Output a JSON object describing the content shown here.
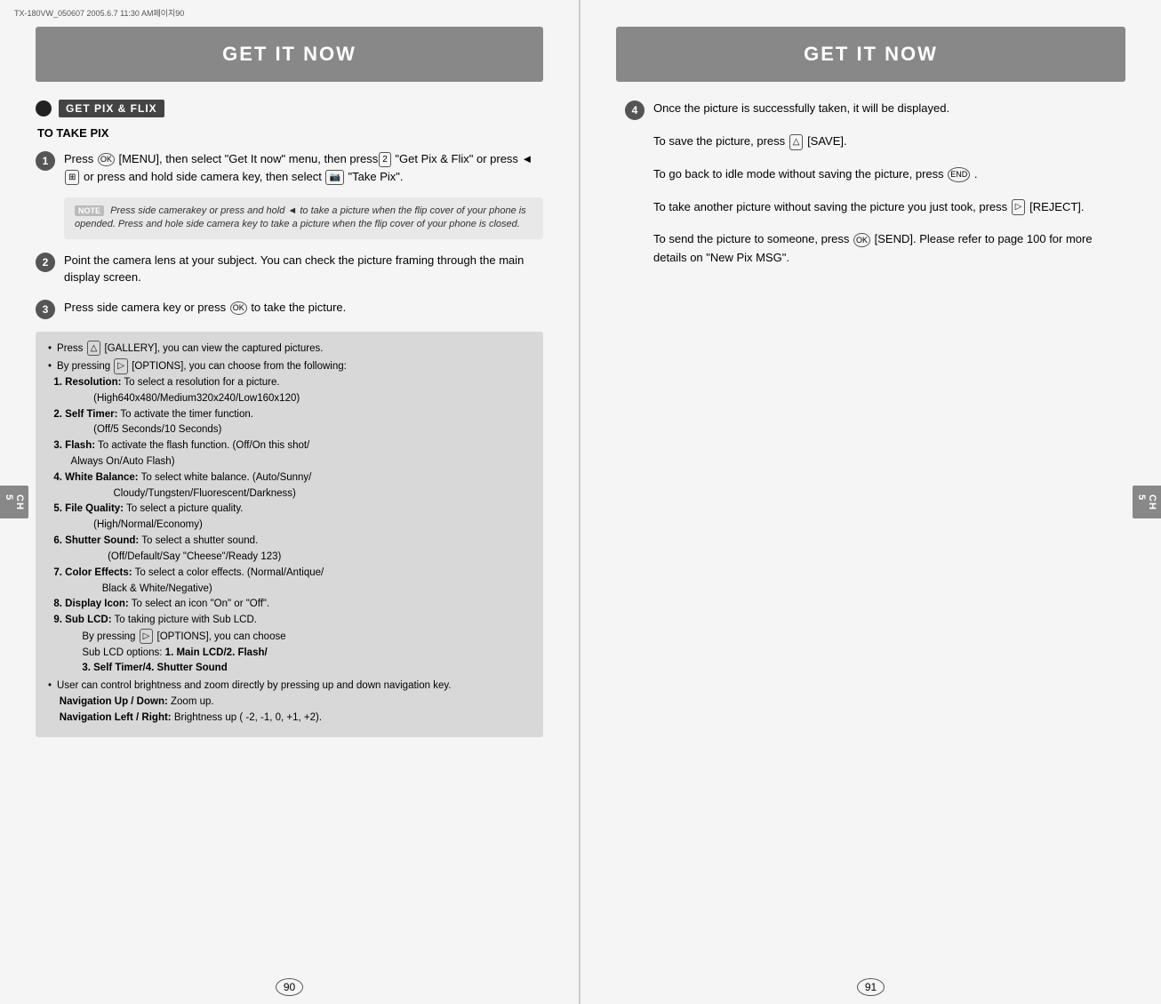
{
  "meta": {
    "top_meta": "TX-180VW_050607  2005.6.7 11:30 AM페이지90"
  },
  "left": {
    "banner_title": "GET IT NOW",
    "section_tag": "GET PIX & FLIX",
    "subsection_title": "TO TAKE PIX",
    "steps": [
      {
        "number": "1",
        "text": "Press [MENU], then select \"Get It now\" menu, then press \"Get Pix & Flix\" or press ◄ or press and hold side camera key, then select \"Take Pix\"."
      },
      {
        "number": "2",
        "text": "Point the camera lens at your subject. You can check the picture framing through the main display screen."
      },
      {
        "number": "3",
        "text": "Press side camera key or press      to take the picture."
      }
    ],
    "note_label": "NOTE",
    "note_text": "Press side camerakey or press and hold ◄  to take a picture when the flip cover of your phone is opended. Press and hole side camera key to take a picture when the flip cover of your phone is closed.",
    "info_bullets": [
      "Press  [GALLERY], you can view the captured pictures.",
      "By pressing  [OPTIONS], you can choose from the following:"
    ],
    "info_options": [
      "1. Resolution: To select a resolution for a picture.",
      "(High640x480/Medium320x240/Low160x120)",
      "2. Self Timer: To activate the timer function.",
      "(Off/5 Seconds/10 Seconds)",
      "3. Flash: To activate the flash function. (Off/On this shot/ Always On/Auto Flash)",
      "4. White Balance: To select white balance. (Auto/Sunny/ Cloudy/Tungsten/Fluorescent/Darkness)",
      "5. File Quality: To select a picture quality.",
      "(High/Normal/Economy)",
      "6. Shutter Sound: To select a shutter sound.",
      "(Off/Default/Say \"Cheese\"/Ready 123)",
      "7. Color Effects: To select a color effects. (Normal/Antique/ Black & White/Negative)",
      "8. Display Icon: To select an icon \"On\" or \"Off\".",
      "9. Sub LCD: To taking picture with Sub LCD.",
      "By pressing  [OPTIONS], you can choose Sub LCD options: 1. Main LCD/2. Flash/ 3. Self Timer/4. Shutter Sound"
    ],
    "info_nav": [
      "User can control brightness and zoom directly by pressing up and down navigation key.",
      "Navigation Up / Down: Zoom up.",
      "Navigation Left / Right: Brightness up ( -2, -1, 0, +1, +2)."
    ],
    "page_number": "90",
    "ch5_label": "CH\n5"
  },
  "right": {
    "banner_title": "GET IT NOW",
    "step4_number": "4",
    "step4_text": "Once the picture is successfully taken, it will be displayed.",
    "paragraphs": [
      "To save the picture, press  [SAVE].",
      "To go back to idle mode without saving the picture, press     .",
      "To take another picture without saving the picture you just took, press  [REJECT].",
      "To send the picture to someone, press  [SEND]. Please refer to page 100 for more details on \"New Pix MSG\"."
    ],
    "page_number": "91",
    "ch5_label": "CH\n5"
  }
}
